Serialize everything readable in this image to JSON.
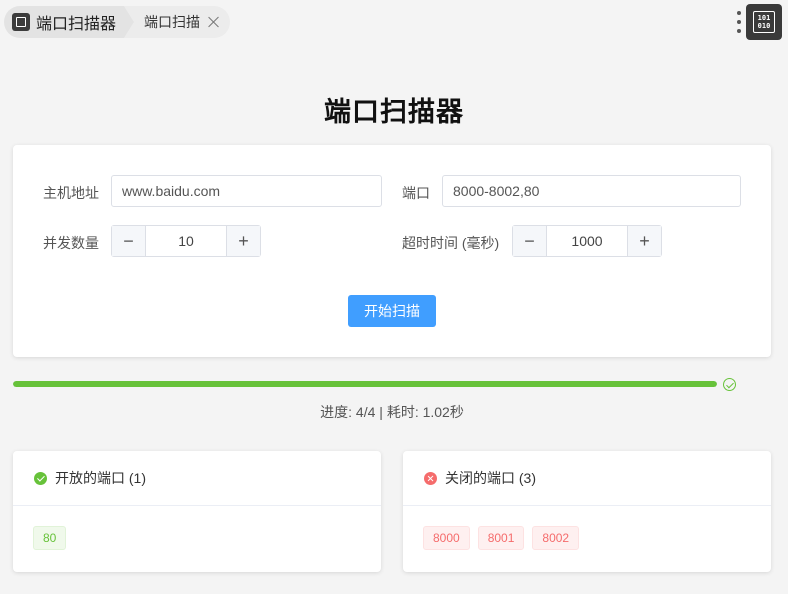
{
  "breadcrumb": {
    "app_title": "端口扫描器",
    "tab_label": "端口扫描"
  },
  "page": {
    "title": "端口扫描器"
  },
  "form": {
    "host_label": "主机地址",
    "host_value": "www.baidu.com",
    "port_label": "端口",
    "port_value": "8000-8002,80",
    "concurrency_label": "并发数量",
    "concurrency_value": "10",
    "timeout_label": "超时时间 (毫秒)",
    "timeout_value": "1000",
    "minus_symbol": "−",
    "plus_symbol": "+",
    "start_button_label": "开始扫描"
  },
  "progress": {
    "percent": 100,
    "text": "进度: 4/4 | 耗时: 1.02秒"
  },
  "results": {
    "open": {
      "title": "开放的端口 (1)",
      "ports": [
        "80"
      ]
    },
    "closed": {
      "title": "关闭的端口 (3)",
      "ports": [
        "8000",
        "8001",
        "8002"
      ]
    }
  },
  "colors": {
    "primary": "#409eff",
    "success": "#67c23a",
    "danger": "#f56c6c"
  },
  "icons": [
    "app-icon",
    "close-icon",
    "more-icon",
    "binary-icon",
    "check-circle-icon",
    "error-circle-icon"
  ]
}
